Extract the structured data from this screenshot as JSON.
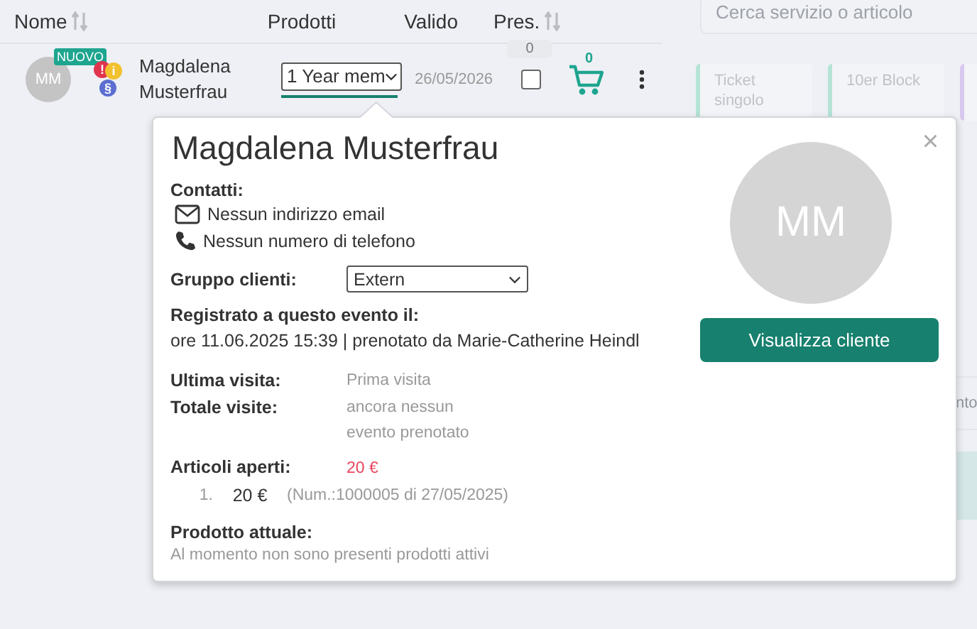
{
  "table": {
    "columns": [
      {
        "label": "Nome",
        "sortable": true
      },
      {
        "label": "Prodotti",
        "sortable": false
      },
      {
        "label": "Valido",
        "sortable": false
      },
      {
        "label": "Pres.",
        "sortable": true
      }
    ],
    "rows": [
      {
        "initials": "MM",
        "badge": "NUOVO",
        "status_dots": [
          {
            "symbol": "!",
            "color": "#e0344f"
          },
          {
            "symbol": "i",
            "color": "#f2c12e"
          },
          {
            "symbol": "§",
            "color": "#5b6fd0"
          }
        ],
        "name": "Magdalena Musterfrau",
        "product": "1 Year mem",
        "valid": "26/05/2026",
        "presence_count": "0",
        "present": false,
        "cart_count": "0"
      }
    ]
  },
  "search": {
    "placeholder": "Cerca servizio o articolo"
  },
  "product_tiles": [
    {
      "label": "Ticket singolo",
      "color": "#b5e3d6"
    },
    {
      "label": "10er Block",
      "color": "#b5e3d6"
    },
    {
      "color": "#d9c8ee"
    }
  ],
  "side_fragment": "nto",
  "popover": {
    "title": "Magdalena Musterfrau",
    "close": "×",
    "initials": "MM",
    "button": "Visualizza cliente",
    "contacts_label": "Contatti:",
    "contacts": [
      {
        "kind": "email",
        "text": "Nessun indirizzo email"
      },
      {
        "kind": "phone",
        "text": "Nessun numero di telefono"
      }
    ],
    "group": {
      "label": "Gruppo clienti:",
      "value": "Extern"
    },
    "registered": {
      "label": "Registrato a questo evento il:",
      "text": "ore 11.06.2025 15:39 | prenotato da Marie-Catherine Heindl"
    },
    "stats": [
      {
        "label": "Ultima visita:",
        "lines": [
          "Prima visita"
        ]
      },
      {
        "label": "Totale visite:",
        "lines": [
          "ancora nessun",
          "evento prenotato"
        ]
      }
    ],
    "open_items": {
      "label": "Articoli aperti:",
      "total": "20 €",
      "items": [
        {
          "index": "1.",
          "amount": "20 €",
          "ref": "(Num.:1000005 di 27/05/2025)"
        }
      ]
    },
    "current_product": {
      "label": "Prodotto attuale:",
      "text": "Al momento non sono presenti prodotti attivi"
    }
  }
}
